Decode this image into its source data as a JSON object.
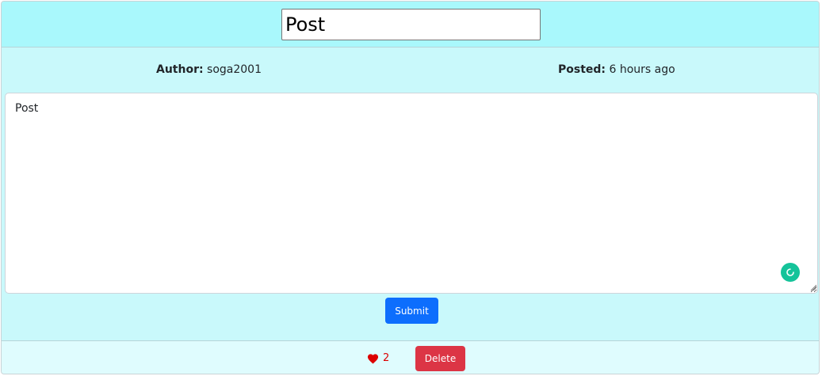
{
  "post": {
    "title_value": "Post",
    "author_label": "Author:",
    "author_value": "soga2001",
    "posted_label": "Posted:",
    "posted_value": "6 hours ago",
    "body_value": "Post"
  },
  "actions": {
    "submit_label": "Submit",
    "like_count": "2",
    "delete_label": "Delete"
  },
  "icons": {
    "like": "heart-icon",
    "grammar": "grammarly-badge-icon"
  },
  "colors": {
    "header_bg": "#a9f8fc",
    "body_bg": "#c9f9fb",
    "footer_bg": "#dffcfe",
    "primary": "#0d6efd",
    "danger": "#dc3545",
    "heart": "#dc0000"
  }
}
